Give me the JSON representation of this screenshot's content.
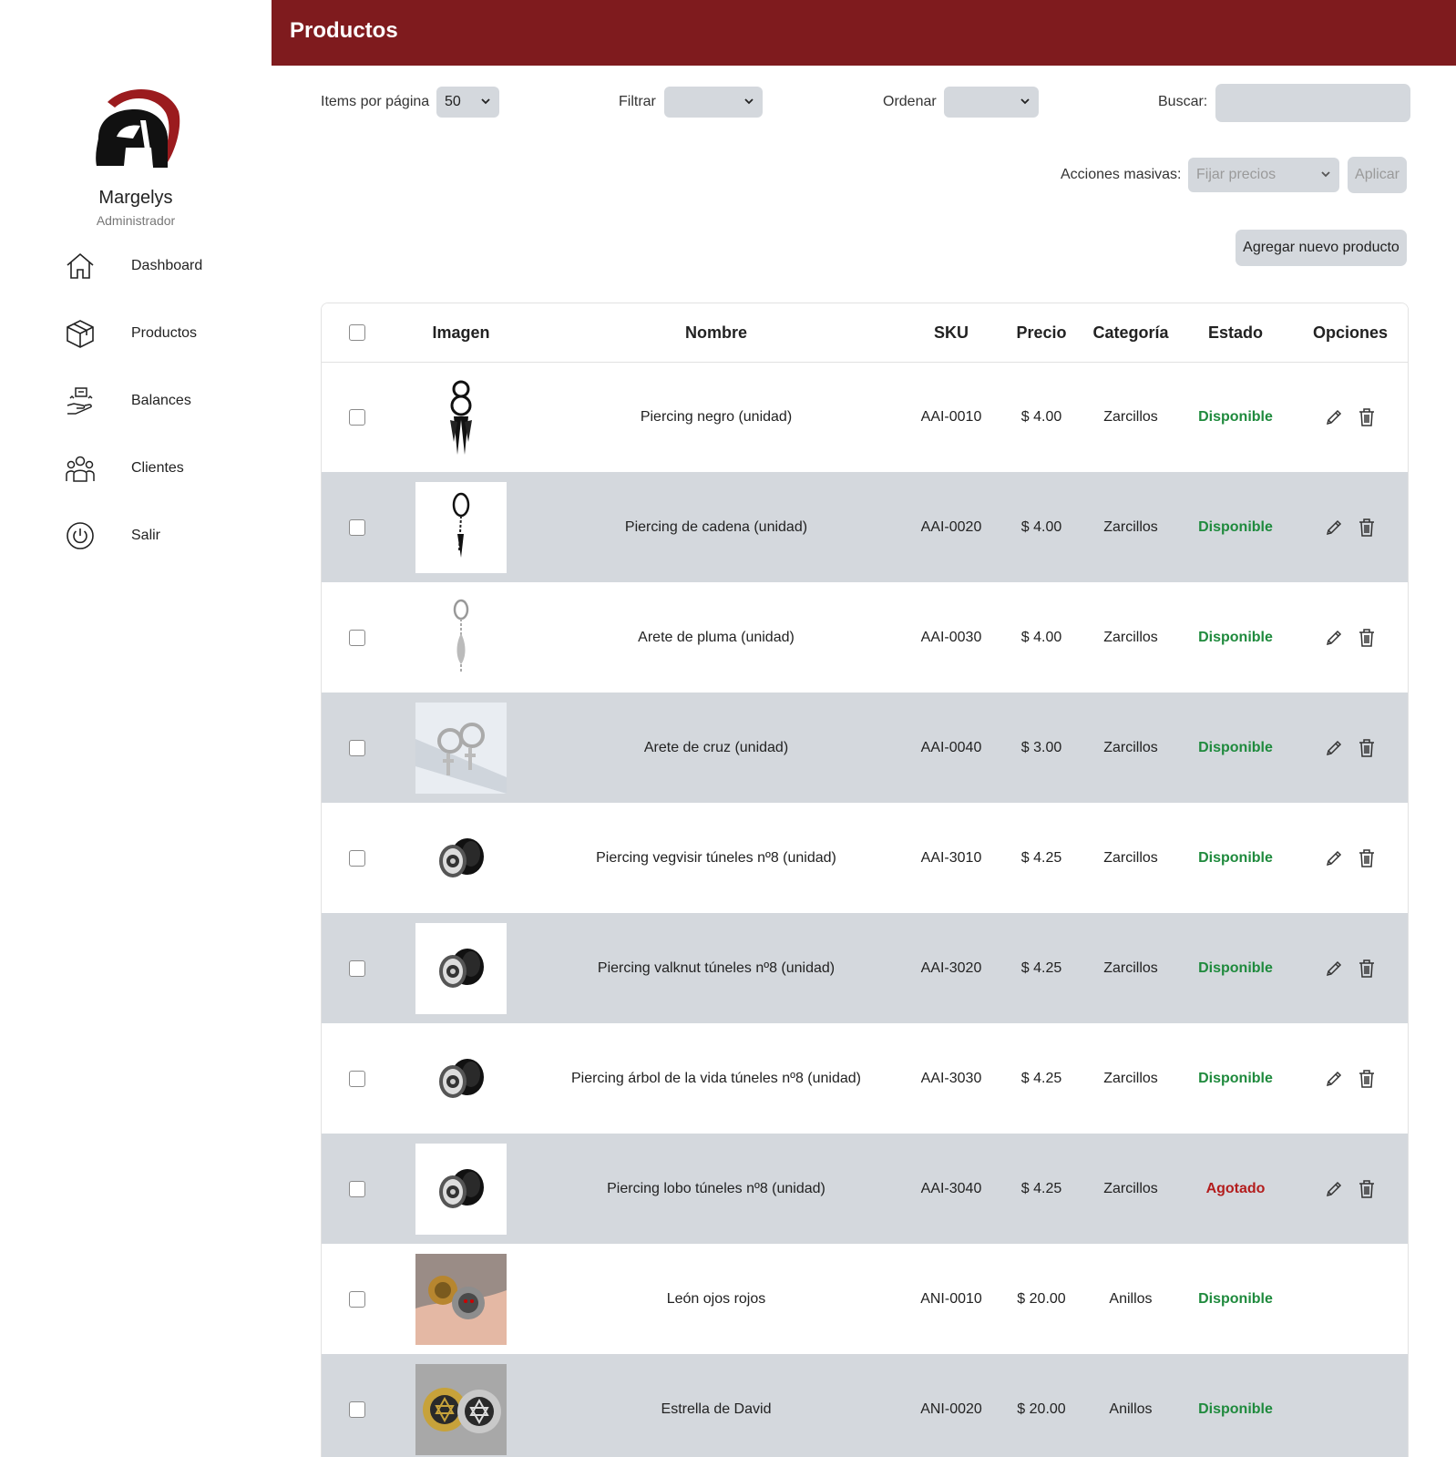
{
  "sidebar": {
    "user_name": "Margelys",
    "user_role": "Administrador",
    "items": [
      {
        "label": "Dashboard",
        "icon": "home-icon"
      },
      {
        "label": "Productos",
        "icon": "box-icon"
      },
      {
        "label": "Balances",
        "icon": "balance-icon"
      },
      {
        "label": "Clientes",
        "icon": "users-icon"
      },
      {
        "label": "Salir",
        "icon": "power-icon"
      }
    ]
  },
  "header": {
    "title": "Productos",
    "color": "#7f1b1e"
  },
  "controls": {
    "items_per_page_label": "Items por página",
    "items_per_page_value": "50",
    "filter_label": "Filtrar",
    "filter_value": "",
    "sort_label": "Ordenar",
    "sort_value": "",
    "search_label": "Buscar:",
    "search_value": "",
    "bulk_label": "Acciones masivas:",
    "bulk_value": "Fijar precios",
    "apply_label": "Aplicar",
    "add_product_label": "Agregar nuevo producto"
  },
  "table": {
    "columns": [
      "Imagen",
      "Nombre",
      "SKU",
      "Precio",
      "Categoría",
      "Estado",
      "Opciones"
    ],
    "rows": [
      {
        "name": "Piercing negro (unidad)",
        "sku": "AAI-0010",
        "price": "$ 4.00",
        "category": "Zarcillos",
        "status": "Disponible",
        "image": "black-spike-earring"
      },
      {
        "name": "Piercing de cadena (unidad)",
        "sku": "AAI-0020",
        "price": "$ 4.00",
        "category": "Zarcillos",
        "status": "Disponible",
        "image": "chain-earring"
      },
      {
        "name": "Arete de pluma (unidad)",
        "sku": "AAI-0030",
        "price": "$ 4.00",
        "category": "Zarcillos",
        "status": "Disponible",
        "image": "feather-earring"
      },
      {
        "name": "Arete de cruz (unidad)",
        "sku": "AAI-0040",
        "price": "$ 3.00",
        "category": "Zarcillos",
        "status": "Disponible",
        "image": "cross-earring"
      },
      {
        "name": "Piercing vegvisir túneles nº8 (unidad)",
        "sku": "AAI-3010",
        "price": "$ 4.25",
        "category": "Zarcillos",
        "status": "Disponible",
        "image": "tunnel-plug"
      },
      {
        "name": "Piercing valknut túneles nº8 (unidad)",
        "sku": "AAI-3020",
        "price": "$ 4.25",
        "category": "Zarcillos",
        "status": "Disponible",
        "image": "tunnel-plug"
      },
      {
        "name": "Piercing árbol de la vida túneles nº8 (unidad)",
        "sku": "AAI-3030",
        "price": "$ 4.25",
        "category": "Zarcillos",
        "status": "Disponible",
        "image": "tunnel-plug"
      },
      {
        "name": "Piercing lobo túneles nº8 (unidad)",
        "sku": "AAI-3040",
        "price": "$ 4.25",
        "category": "Zarcillos",
        "status": "Agotado",
        "image": "tunnel-plug"
      },
      {
        "name": "León ojos rojos",
        "sku": "ANI-0010",
        "price": "$ 20.00",
        "category": "Anillos",
        "status": "Disponible",
        "image": "lion-ring"
      },
      {
        "name": "Estrella de David",
        "sku": "ANI-0020",
        "price": "$ 20.00",
        "category": "Anillos",
        "status": "Disponible",
        "image": "star-ring"
      }
    ]
  },
  "colors": {
    "available": "#1f8a3d",
    "sold_out": "#b31d1d",
    "row_alt": "#d4d8dd"
  }
}
